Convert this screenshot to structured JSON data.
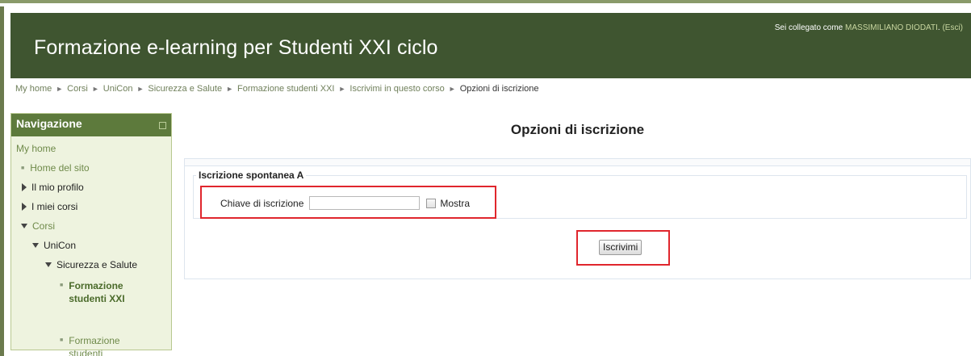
{
  "header": {
    "site_title": "Formazione e-learning per Studenti XXI ciclo",
    "login_prefix": "Sei collegato come ",
    "user_name": "MASSIMILIANO DIODATI",
    "logout_label": "(Esci)"
  },
  "breadcrumb": {
    "separator": "►",
    "items": [
      "My home",
      "Corsi",
      "UniCon",
      "Sicurezza e Salute",
      "Formazione studenti XXI",
      "Iscrivimi in questo corso"
    ],
    "current": "Opzioni di iscrizione"
  },
  "navigation": {
    "title": "Navigazione",
    "my_home": "My home",
    "home_sito": "Home del sito",
    "mio_profilo": "Il mio profilo",
    "miei_corsi": "I miei corsi",
    "corsi": "Corsi",
    "unicon": "UniCon",
    "sicurezza": "Sicurezza e Salute",
    "formazione_current": "Formazione studenti XXI",
    "formazione_other": "Formazione studenti"
  },
  "main": {
    "heading": "Opzioni di iscrizione",
    "fieldset_legend": "Iscrizione spontanea A",
    "key_label": "Chiave di iscrizione",
    "key_value": "",
    "show_label": "Mostra",
    "submit_label": "Iscrivimi"
  },
  "colors": {
    "header_bg": "#3f5530",
    "nav_header_bg": "#5d7a3c",
    "highlight": "#e0262d"
  }
}
